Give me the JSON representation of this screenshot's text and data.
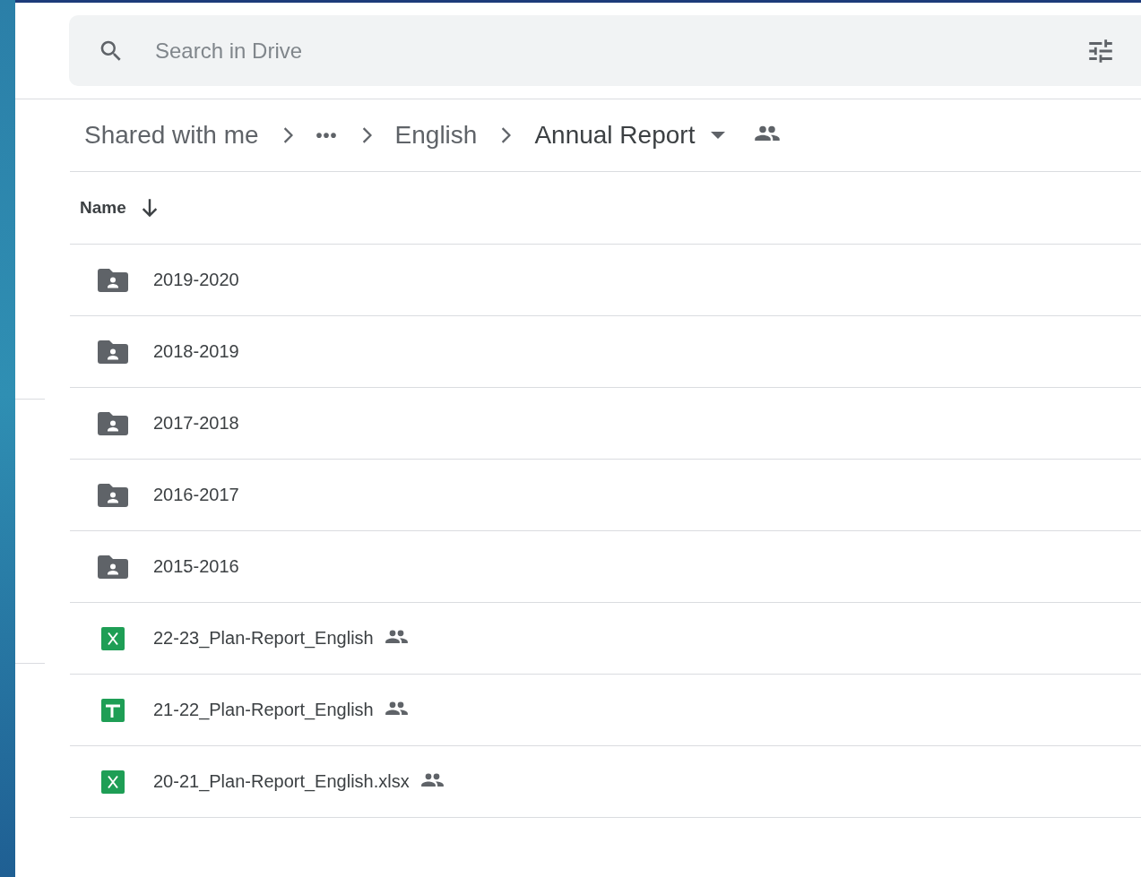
{
  "search": {
    "placeholder": "Search in Drive"
  },
  "breadcrumb": [
    {
      "kind": "text",
      "label": "Shared with me"
    },
    {
      "kind": "more",
      "label": "•••"
    },
    {
      "kind": "text",
      "label": "English"
    },
    {
      "kind": "current",
      "label": "Annual Report",
      "shared": true
    }
  ],
  "table": {
    "columns": [
      {
        "label": "Name",
        "sort_descending": true
      }
    ],
    "rows": [
      {
        "kind": "shared-folder",
        "name": "2019-2020",
        "shared": false
      },
      {
        "kind": "shared-folder",
        "name": "2018-2019",
        "shared": false
      },
      {
        "kind": "shared-folder",
        "name": "2017-2018",
        "shared": false
      },
      {
        "kind": "shared-folder",
        "name": "2016-2017",
        "shared": false
      },
      {
        "kind": "shared-folder",
        "name": "2015-2016",
        "shared": false
      },
      {
        "kind": "excel",
        "name": "22-23_Plan-Report_English",
        "shared": true
      },
      {
        "kind": "sheets",
        "name": "21-22_Plan-Report_English",
        "shared": true
      },
      {
        "kind": "excel",
        "name": "20-21_Plan-Report_English.xlsx",
        "shared": true
      }
    ]
  }
}
